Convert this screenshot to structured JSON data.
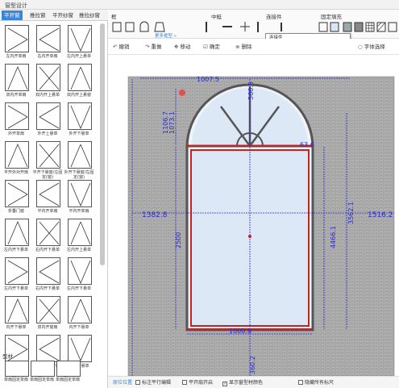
{
  "window": {
    "title": "窗型设计"
  },
  "left_panel": {
    "tabs": [
      {
        "label": "平开窗",
        "active": true
      },
      {
        "label": "推拉窗",
        "active": false
      },
      {
        "label": "平开纱窗",
        "active": false
      },
      {
        "label": "推拉纱窗",
        "active": false
      }
    ],
    "items": [
      "左内开单扇",
      "右内开单扇",
      "左内开上悬单",
      "双内开单扇",
      "双内开上悬单",
      "双内开上悬窗",
      "外开单扇",
      "外开上悬单",
      "外开下悬单",
      "平开外对开扇",
      "平开下悬窗/左固定(窗)",
      "外开下悬窗/左固定(窗)",
      "折叠门窗",
      "平内开单扇",
      "平内开单扇",
      "左内开下悬单",
      "右内开下悬单",
      "左内开上悬单",
      "左内开下悬单",
      "右内开下悬单",
      "左内开下悬单",
      "内开下悬单",
      "双内开窗扇",
      "内开下悬单",
      "内开下悬窗",
      "平开内对开扇",
      "内开下悬单"
    ],
    "section_label": "型材",
    "bottom_items": [
      "单扇固定单扇",
      "单扇固定单扇",
      "单扇固定单扇"
    ]
  },
  "toolbar": {
    "groups": [
      {
        "label": "框"
      },
      {
        "label": "中梃"
      },
      {
        "label": "连接件"
      },
      {
        "label": "固定填充"
      }
    ],
    "more_link": "更多框型 »",
    "popup_label": "连接件"
  },
  "action_bar": {
    "undo": "撤销",
    "redo": "重做",
    "move": "移动",
    "confirm": "确定",
    "delete": "删除",
    "font_select": "字体选择"
  },
  "drawing": {
    "dim_top": "1007.5",
    "dim_arch_top": "566.5",
    "dim_arch_height": "1073.1",
    "dim_arch_left": "1106.7",
    "dim_corner": "63.6",
    "dim_left_total": "1382.8",
    "dim_left_inner": "2500",
    "dim_right_inner": "4466.1",
    "dim_right_total": "1516.2",
    "dim_right_mid": "3562.1",
    "dim_bottom": "1000.8",
    "dim_bottom2": "360.2",
    "colors": {
      "frame_red": "#cc1f1f",
      "dim_blue": "#2a2acc",
      "glass": "#dce8f6",
      "wall_fill": "#b8b8b8",
      "accent": "#3b86d8"
    }
  },
  "status_bar": {
    "left_link": "原位位置",
    "options": [
      {
        "label": "标注平行编辑",
        "checked": false
      },
      {
        "label": "平开扇开启",
        "checked": false
      },
      {
        "label": "显示窗型材颜色",
        "checked": true
      },
      {
        "label": "隐藏所有标尺",
        "checked": false
      }
    ]
  }
}
